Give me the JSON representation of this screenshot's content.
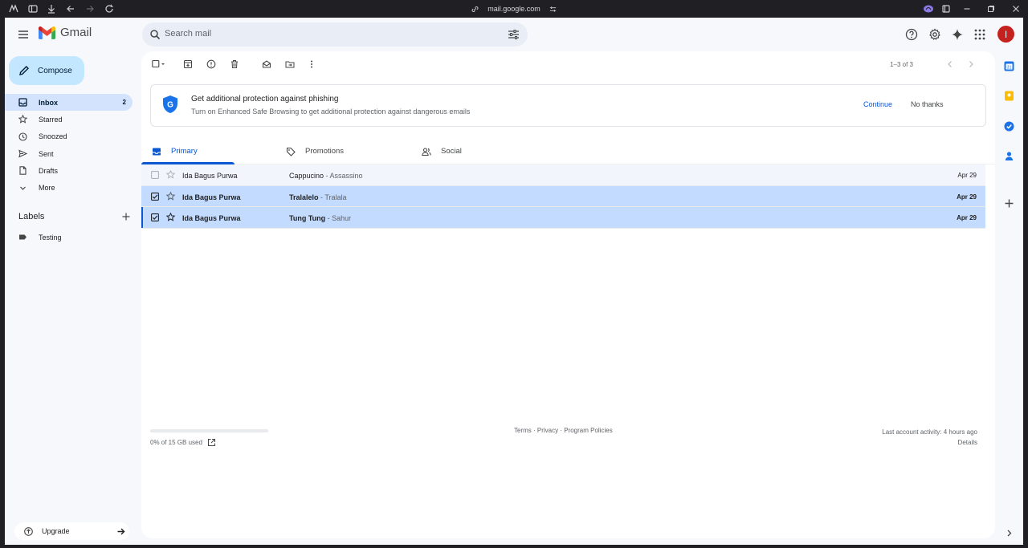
{
  "browser": {
    "url": "mail.google.com"
  },
  "header": {
    "app_name": "Gmail",
    "search_placeholder": "Search mail",
    "avatar_initial": "I"
  },
  "sidebar": {
    "compose_label": "Compose",
    "items": [
      {
        "label": "Inbox",
        "icon": "inbox-icon",
        "count": "2",
        "active": true
      },
      {
        "label": "Starred",
        "icon": "star-icon",
        "count": ""
      },
      {
        "label": "Snoozed",
        "icon": "clock-icon",
        "count": ""
      },
      {
        "label": "Sent",
        "icon": "send-icon",
        "count": ""
      },
      {
        "label": "Drafts",
        "icon": "draft-icon",
        "count": ""
      },
      {
        "label": "More",
        "icon": "chevron-down-icon",
        "count": ""
      }
    ],
    "labels_title": "Labels",
    "labels": [
      {
        "label": "Testing",
        "icon": "label-icon"
      }
    ],
    "upgrade_label": "Upgrade"
  },
  "toolbar": {
    "pager_text": "1–3 of 3"
  },
  "banner": {
    "title": "Get additional protection against phishing",
    "subtitle": "Turn on Enhanced Safe Browsing to get additional protection against dangerous emails",
    "continue_label": "Continue",
    "dismiss_label": "No thanks"
  },
  "tabs": [
    {
      "label": "Primary",
      "icon": "inbox-icon",
      "active": true
    },
    {
      "label": "Promotions",
      "icon": "tag-icon",
      "active": false
    },
    {
      "label": "Social",
      "icon": "people-icon",
      "active": false
    }
  ],
  "emails": [
    {
      "sender": "Ida Bagus Purwa",
      "subject": "Cappucino",
      "snippet": " - Assassino",
      "date": "Apr 29",
      "checked": false,
      "unread": false
    },
    {
      "sender": "Ida Bagus Purwa",
      "subject": "Tralalelo",
      "snippet": " - Tralala",
      "date": "Apr 29",
      "checked": true,
      "unread": true
    },
    {
      "sender": "Ida Bagus Purwa",
      "subject": "Tung Tung",
      "snippet": " - Sahur",
      "date": "Apr 29",
      "checked": true,
      "unread": true
    }
  ],
  "footer": {
    "storage_fraction": 0.0,
    "storage_text": "0% of 15 GB used",
    "links": "Terms · Privacy · Program Policies",
    "activity": "Last account activity: 4 hours ago",
    "details": "Details"
  },
  "colors": {
    "accent": "#0b57d0",
    "selected_row": "#c2dbff",
    "compose_bg": "#c2e7ff",
    "active_nav": "#d3e3fd",
    "avatar": "#c5221f"
  }
}
